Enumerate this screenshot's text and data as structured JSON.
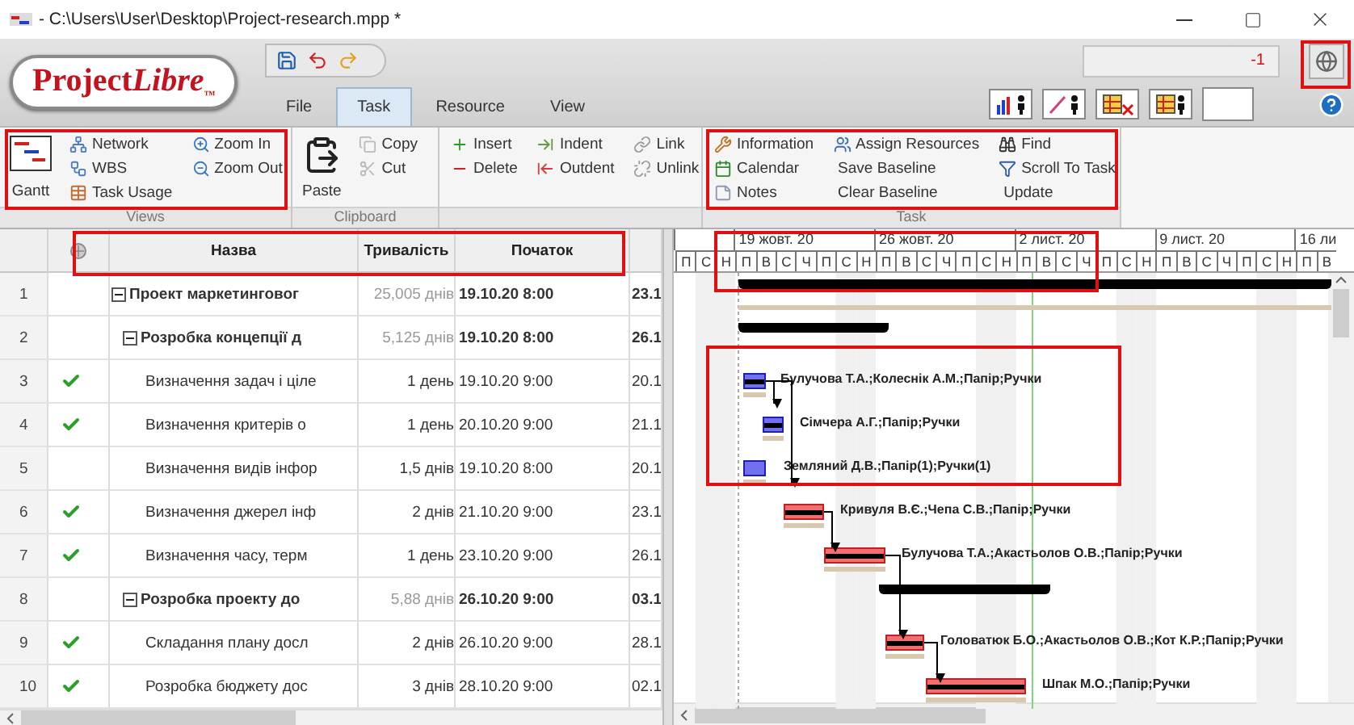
{
  "window": {
    "title": "- C:\\Users\\User\\Desktop\\Project-research.mpp *"
  },
  "logo": {
    "text": "Project",
    "accent": "Libre",
    "mark": "™"
  },
  "tabs": [
    {
      "label": "File",
      "selected": false
    },
    {
      "label": "Task",
      "selected": true
    },
    {
      "label": "Resource",
      "selected": false
    },
    {
      "label": "View",
      "selected": false
    }
  ],
  "top_field": {
    "value": "-1"
  },
  "ribbon": {
    "groups": [
      {
        "label": "Views",
        "columns": [
          [
            {
              "label": "Gantt",
              "kind": "large"
            }
          ],
          [
            {
              "label": "Network",
              "kind": "small"
            },
            {
              "label": "WBS",
              "kind": "small"
            },
            {
              "label": "Task Usage",
              "kind": "small"
            }
          ],
          [
            {
              "label": "Zoom In",
              "kind": "small"
            },
            {
              "label": "Zoom Out",
              "kind": "small"
            }
          ]
        ]
      },
      {
        "label": "Clipboard",
        "columns": [
          [
            {
              "label": "Paste",
              "kind": "large"
            }
          ],
          [
            {
              "label": "Copy",
              "kind": "small"
            },
            {
              "label": "Cut",
              "kind": "small"
            }
          ]
        ]
      },
      {
        "columns": [
          [
            {
              "label": "Insert",
              "kind": "small"
            },
            {
              "label": "Delete",
              "kind": "small"
            }
          ],
          [
            {
              "label": "Indent",
              "kind": "small"
            },
            {
              "label": "Outdent",
              "kind": "small"
            }
          ],
          [
            {
              "label": "Link",
              "kind": "small"
            },
            {
              "label": "Unlink",
              "kind": "small"
            }
          ]
        ]
      },
      {
        "label": "Task",
        "columns": [
          [
            {
              "label": "Information",
              "kind": "small"
            },
            {
              "label": "Calendar",
              "kind": "small"
            },
            {
              "label": "Notes",
              "kind": "small"
            }
          ],
          [
            {
              "label": "Assign Resources",
              "kind": "small"
            },
            {
              "label": "Save Baseline",
              "kind": "small"
            },
            {
              "label": "Clear Baseline",
              "kind": "small"
            }
          ],
          [
            {
              "label": "Find",
              "kind": "small"
            },
            {
              "label": "Scroll To Task",
              "kind": "small"
            },
            {
              "label": "Update",
              "kind": "small"
            }
          ]
        ]
      }
    ]
  },
  "table": {
    "columns": [
      "Назва",
      "Тривалість",
      "Початок"
    ],
    "rows": [
      {
        "id": "1",
        "kind": "summary",
        "expanded": true,
        "done": false,
        "name": "Проект маркетинговог",
        "duration": "25,005 днів",
        "start": "19.10.20 8:00",
        "finish": "23.1",
        "children": [
          {
            "id": "2",
            "kind": "summary",
            "expanded": true,
            "done": false,
            "name": "Розробка концепції д",
            "duration": "5,125 днів",
            "start": "19.10.20 8:00",
            "finish": "26.1",
            "children": [
              {
                "id": "3",
                "kind": "task",
                "done": true,
                "critical": false,
                "name": "Визначення задач і ціле",
                "duration": "1 день",
                "start": "19.10.20 9:00",
                "finish": "20.1",
                "resources": "Булучова Т.А.;Колеснік А.М.;Папір;Ручки"
              },
              {
                "id": "4",
                "kind": "task",
                "done": true,
                "critical": false,
                "name": "Визначення критерів о",
                "duration": "1 день",
                "start": "20.10.20 9:00",
                "finish": "21.1",
                "resources": "Сімчера А.Г.;Папір;Ручки"
              },
              {
                "id": "5",
                "kind": "task",
                "done": false,
                "critical": false,
                "name": "Визначення видів інфор",
                "duration": "1,5 днів",
                "start": "19.10.20 8:00",
                "finish": "20.1",
                "resources": "Земляний Д.В.;Папір(1);Ручки(1)"
              },
              {
                "id": "6",
                "kind": "task",
                "done": true,
                "critical": true,
                "name": "Визначення джерел інф",
                "duration": "2 днів",
                "start": "21.10.20 9:00",
                "finish": "23.1",
                "resources": "Кривуля В.Є.;Чепа С.В.;Папір;Ручки"
              },
              {
                "id": "7",
                "kind": "task",
                "done": true,
                "critical": true,
                "name": "Визначення часу, терм",
                "duration": "1 день",
                "start": "23.10.20 9:00",
                "finish": "26.1",
                "resources": "Булучова Т.А.;Акастьолов О.В.;Папір;Ручки"
              }
            ]
          },
          {
            "id": "8",
            "kind": "summary",
            "expanded": true,
            "done": false,
            "name": "Розробка проекту до",
            "duration": "5,88 днів",
            "start": "26.10.20 9:00",
            "finish": "03.1",
            "children": [
              {
                "id": "9",
                "kind": "task",
                "done": true,
                "critical": true,
                "name": "Складання плану досл",
                "duration": "2 днів",
                "start": "26.10.20 9:00",
                "finish": "28.1",
                "resources": "Головатюк Б.О.;Акастьолов О.В.;Кот К.Р.;Папір;Ручки"
              },
              {
                "id": "10",
                "kind": "task",
                "done": true,
                "critical": true,
                "name": "Розробка бюджету дос",
                "duration": "3 днів",
                "start": "28.10.20 9:00",
                "finish": "02.1",
                "resources": "Шпак М.О.;Папір;Ручки"
              }
            ]
          }
        ]
      }
    ]
  },
  "timescale": {
    "weeks": [
      "19 жовт. 20",
      "26 жовт. 20",
      "2 лист. 20",
      "9 лист. 20",
      "16 ли"
    ],
    "days": [
      "П",
      "С",
      "Н",
      "П",
      "В",
      "С",
      "Ч",
      "П",
      "С",
      "Н",
      "П",
      "В",
      "С",
      "Ч",
      "П",
      "С",
      "Н",
      "П",
      "В",
      "С",
      "Ч",
      "П",
      "С",
      "Н",
      "П",
      "В",
      "С",
      "Ч",
      "П",
      "С",
      "Н",
      "П",
      "В"
    ]
  }
}
